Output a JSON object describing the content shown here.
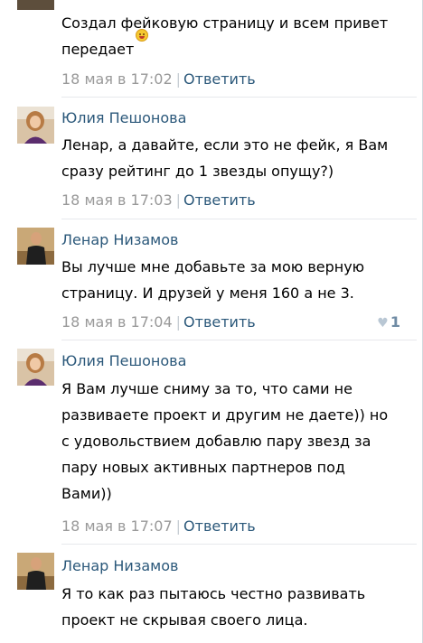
{
  "comments": [
    {
      "text": "Создал фейковую страницу и всем привет\nпередает",
      "has_emoji": true,
      "date": "18 мая в 17:02",
      "reply_label": "Ответить"
    },
    {
      "author": "Юлия Пешонова",
      "avatar_icon": "user-avatar-woman",
      "text": "Ленар, а давайте, если это не фейк, я Вам\nсразу рейтинг до 1 звезды опущу?)",
      "date": "18 мая в 17:03",
      "reply_label": "Ответить"
    },
    {
      "author": "Ленар Низамов",
      "avatar_icon": "user-avatar-man",
      "text": "Вы лучше мне добавьте за мою верную\nстраницу. И друзей у меня 160 а не 3.",
      "date": "18 мая в 17:04",
      "reply_label": "Ответить",
      "likes": "1"
    },
    {
      "author": "Юлия Пешонова",
      "avatar_icon": "user-avatar-woman",
      "text": "Я Вам лучше сниму за то, что сами не\nразвиваете проект и другим не даете)) но\nс удовольствием добавлю пару звезд за\nпару новых активных партнеров под\nВами))",
      "date": "18 мая в 17:07",
      "reply_label": "Ответить"
    },
    {
      "author": "Ленар Низамов",
      "avatar_icon": "user-avatar-man",
      "text": "Я то как раз пытаюсь честно развивать\nпроект не скрывая своего лица."
    }
  ],
  "colors": {
    "link": "#2b587a",
    "date": "#999999",
    "separator": "#e7e8ec"
  }
}
